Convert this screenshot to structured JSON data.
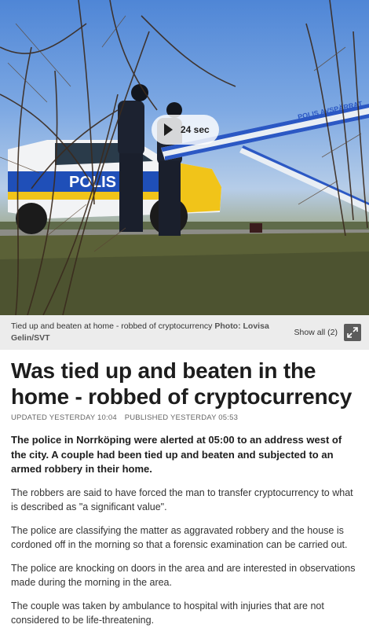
{
  "hero": {
    "video_duration": "24 sec",
    "tape_text": "POLIS AVSPÄRRAT",
    "car_text": "POLIS"
  },
  "caption": {
    "text": "Tied up and beaten at home - robbed of cryptocurrency",
    "credit": "Photo: Lovisa Gelin/SVT",
    "show_all": "Show all (2)"
  },
  "article": {
    "headline": "Was tied up and beaten in the home - robbed of cryptocurrency",
    "updated": "UPDATED YESTERDAY 10:04",
    "published": "PUBLISHED YESTERDAY 05:53",
    "lede": "The police in Norrköping were alerted at 05:00 to an address west of the city. A couple had been tied up and beaten and subjected to an armed robbery in their home.",
    "paragraphs": [
      "The robbers are said to have forced the man to transfer cryptocurrency to what is described as \"a significant value\".",
      "The police are classifying the matter as aggravated robbery and the house is cordoned off in the morning so that a forensic examination can be carried out.",
      "The police are knocking on doors in the area and are interested in observations made during the morning in the area.",
      "The couple was taken by ambulance to hospital with injuries that are not considered to be life-threatening."
    ]
  }
}
